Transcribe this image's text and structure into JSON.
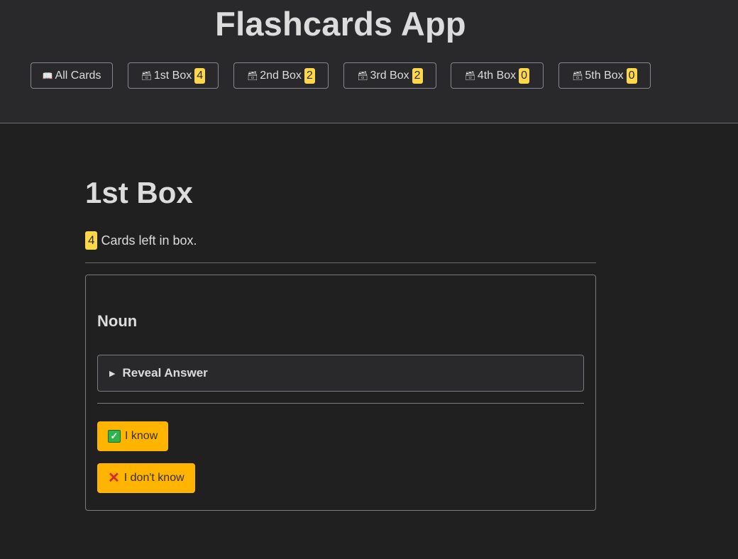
{
  "app": {
    "title": "Flashcards App"
  },
  "nav": {
    "items": [
      {
        "label": "All Cards",
        "icon": "open-book-icon",
        "glyph": "📖"
      },
      {
        "label": "1st Box",
        "icon": "card-stack-icon",
        "glyph": "🗃",
        "count": "4"
      },
      {
        "label": "2nd Box",
        "icon": "card-stack-icon",
        "glyph": "🗃",
        "count": "2"
      },
      {
        "label": "3rd Box",
        "icon": "card-stack-icon",
        "glyph": "🗃",
        "count": "2"
      },
      {
        "label": "4th Box",
        "icon": "card-stack-icon",
        "glyph": "🗃",
        "count": "0"
      },
      {
        "label": "5th Box",
        "icon": "card-stack-icon",
        "glyph": "🗃",
        "count": "0"
      }
    ]
  },
  "box": {
    "title": "1st Box",
    "count": "4",
    "count_text": "Cards left in box."
  },
  "card": {
    "word": "Noun",
    "reveal_label": "Reveal Answer",
    "know_label": "I know",
    "dont_know_label": "I don't know"
  },
  "colors": {
    "background": "#202021",
    "header": "#29292b",
    "badge": "#ffd84a",
    "action_button": "#ffb400"
  }
}
